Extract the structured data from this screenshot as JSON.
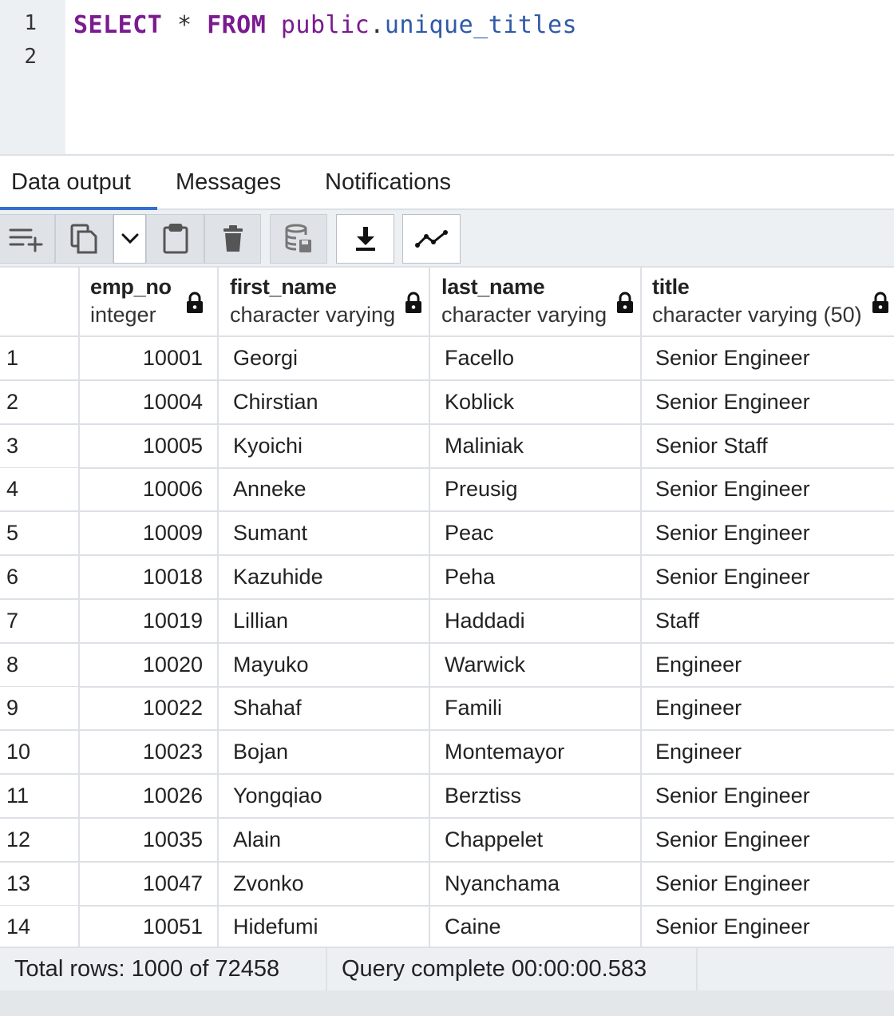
{
  "editor": {
    "line_numbers": [
      "1",
      "2"
    ],
    "query": {
      "select_kw": "SELECT",
      "star": "*",
      "from_kw": "FROM",
      "schema": "public",
      "dot": ".",
      "table": "unique_titles"
    }
  },
  "tabs": [
    {
      "label": "Data output",
      "active": true
    },
    {
      "label": "Messages",
      "active": false
    },
    {
      "label": "Notifications",
      "active": false
    }
  ],
  "toolbar": {
    "buttons": [
      {
        "icon": "add-row-icon"
      },
      {
        "icon": "copy-icon"
      },
      {
        "icon": "chevron-down-icon"
      },
      {
        "icon": "paste-icon"
      },
      {
        "icon": "delete-icon"
      },
      {
        "icon": "save-data-icon"
      },
      {
        "icon": "download-icon"
      },
      {
        "icon": "graph-visualiser-icon"
      }
    ]
  },
  "grid": {
    "columns": [
      {
        "name": "emp_no",
        "type": "integer"
      },
      {
        "name": "first_name",
        "type": "character varying"
      },
      {
        "name": "last_name",
        "type": "character varying"
      },
      {
        "name": "title",
        "type": "character varying (50)"
      }
    ],
    "rows": [
      {
        "n": "1",
        "emp_no": "10001",
        "first_name": "Georgi",
        "last_name": "Facello",
        "title": "Senior Engineer"
      },
      {
        "n": "2",
        "emp_no": "10004",
        "first_name": "Chirstian",
        "last_name": "Koblick",
        "title": "Senior Engineer"
      },
      {
        "n": "3",
        "emp_no": "10005",
        "first_name": "Kyoichi",
        "last_name": "Maliniak",
        "title": "Senior Staff"
      },
      {
        "n": "4",
        "emp_no": "10006",
        "first_name": "Anneke",
        "last_name": "Preusig",
        "title": "Senior Engineer"
      },
      {
        "n": "5",
        "emp_no": "10009",
        "first_name": "Sumant",
        "last_name": "Peac",
        "title": "Senior Engineer"
      },
      {
        "n": "6",
        "emp_no": "10018",
        "first_name": "Kazuhide",
        "last_name": "Peha",
        "title": "Senior Engineer"
      },
      {
        "n": "7",
        "emp_no": "10019",
        "first_name": "Lillian",
        "last_name": "Haddadi",
        "title": "Staff"
      },
      {
        "n": "8",
        "emp_no": "10020",
        "first_name": "Mayuko",
        "last_name": "Warwick",
        "title": "Engineer"
      },
      {
        "n": "9",
        "emp_no": "10022",
        "first_name": "Shahaf",
        "last_name": "Famili",
        "title": "Engineer"
      },
      {
        "n": "10",
        "emp_no": "10023",
        "first_name": "Bojan",
        "last_name": "Montemayor",
        "title": "Engineer"
      },
      {
        "n": "11",
        "emp_no": "10026",
        "first_name": "Yongqiao",
        "last_name": "Berztiss",
        "title": "Senior Engineer"
      },
      {
        "n": "12",
        "emp_no": "10035",
        "first_name": "Alain",
        "last_name": "Chappelet",
        "title": "Senior Engineer"
      },
      {
        "n": "13",
        "emp_no": "10047",
        "first_name": "Zvonko",
        "last_name": "Nyanchama",
        "title": "Senior Engineer"
      },
      {
        "n": "14",
        "emp_no": "10051",
        "first_name": "Hidefumi",
        "last_name": "Caine",
        "title": "Senior Engineer"
      }
    ]
  },
  "status": {
    "total_rows": "Total rows: 1000 of 72458",
    "query_complete": "Query complete 00:00:00.583"
  },
  "colors": {
    "keyword": "#7a1b8f",
    "table_name": "#2f5aa8",
    "tab_active_underline": "#326fd1",
    "panel_bg": "#edf0f3"
  }
}
